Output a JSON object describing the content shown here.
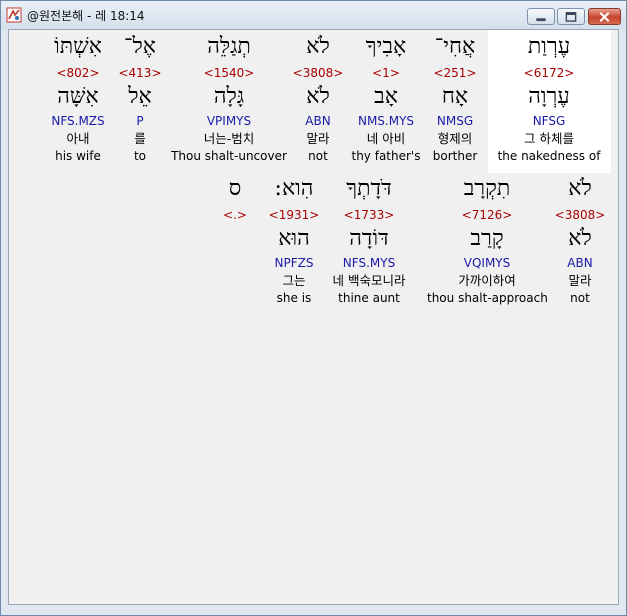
{
  "window": {
    "title": "@원전본해 - 레 18:14"
  },
  "colors": {
    "strong": "#aa0000",
    "morph": "#1a1aa8",
    "highlight": "#ffffff"
  },
  "rows": [
    {
      "words": [
        {
          "heb": "עֶרְוַת",
          "strong": "<6172>",
          "lemma": "עֶרְוָה",
          "morph": "NFSG",
          "kor": "그 하체를",
          "eng": "the nakedness of",
          "highlight": true
        },
        {
          "heb": "אֲחִי־",
          "strong": "<251>",
          "lemma": "אָח",
          "morph": "NMSG",
          "kor": "형제의",
          "eng": "borther"
        },
        {
          "heb": "אָבִיךָ",
          "strong": "<1>",
          "lemma": "אָב",
          "morph": "NMS.MYS",
          "kor": "네 아비",
          "eng": "thy father's"
        },
        {
          "heb": "לֹא",
          "strong": "<3808>",
          "lemma": "לֹא",
          "morph": "ABN",
          "kor": "말라",
          "eng": "not"
        },
        {
          "heb": "תְגַלֵּה",
          "strong": "<1540>",
          "lemma": "גָּלָה",
          "morph": "VPIMYS",
          "kor": "너는-범치",
          "eng": "Thou shalt-uncover"
        },
        {
          "heb": "אֶל־",
          "strong": "<413>",
          "lemma": "אֵל",
          "morph": "P",
          "kor": "를",
          "eng": "to"
        },
        {
          "heb": "אִשְׁתּוֹ",
          "strong": "<802>",
          "lemma": "אִשָּׁה",
          "morph": "NFS.MZS",
          "kor": "아내",
          "eng": "his wife"
        }
      ]
    },
    {
      "words": [
        {
          "heb": "לֹא",
          "strong": "<3808>",
          "lemma": "לֹא",
          "morph": "ABN",
          "kor": "말라",
          "eng": "not"
        },
        {
          "heb": "תִקְרָב",
          "strong": "<7126>",
          "lemma": "קָרַב",
          "morph": "VQIMYS",
          "kor": "가까이하여",
          "eng": "thou shalt-approach"
        },
        {
          "heb": "דֹּדָתְךָ",
          "strong": "<1733>",
          "lemma": "דּוֹדָה",
          "morph": "NFS.MYS",
          "kor": "네 백숙모니라",
          "eng": "thine aunt"
        },
        {
          "heb": "הִוא:",
          "strong": "<1931>",
          "lemma": "הוּא",
          "morph": "NPFZS",
          "kor": "그는",
          "eng": "she is"
        },
        {
          "heb": "ס",
          "strong": "<.>",
          "lemma": "",
          "morph": "",
          "kor": "",
          "eng": ""
        }
      ]
    }
  ]
}
